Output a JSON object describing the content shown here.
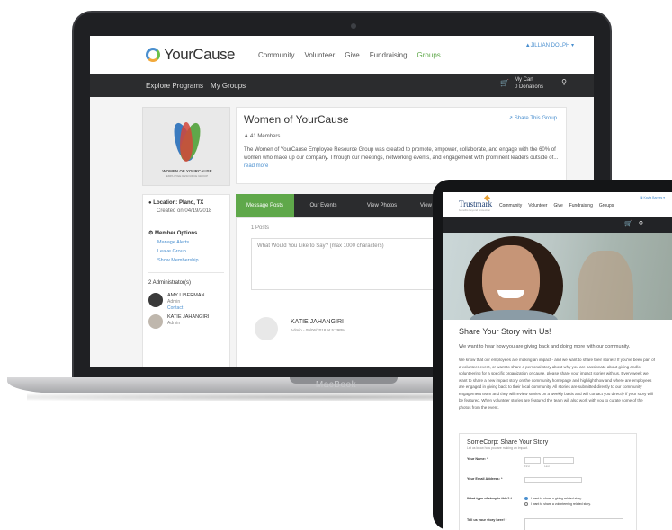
{
  "laptop": {
    "brand_label": "MacBook",
    "app": {
      "logo_text": "YourCause",
      "nav": [
        "Community",
        "Volunteer",
        "Give",
        "Fundraising",
        "Groups"
      ],
      "active_nav": "Groups",
      "user_menu": "▲JILLIAN DOLPH ▾",
      "subnav": [
        "Explore Programs",
        "My Groups"
      ],
      "cart_title": "My Cart",
      "cart_count": "0 Donations",
      "group": {
        "logo_line1": "WOMEN OF YOURCAUSE",
        "logo_line2": "EMPLOYEE RESOURCE GROUP",
        "title": "Women of YourCause",
        "share_label": "Share This Group",
        "members": "41 Members",
        "description": "The Women of YourCause Employee Resource Group was created to promote, empower, collaborate, and engage with the 60% of women who make up our company. Through our meetings, networking events, and engagement with prominent leaders outside of...",
        "read_more": "read more"
      },
      "sidebar": {
        "location": "Location:  Plano, TX",
        "created": "Created on 04/19/2018",
        "options_title": "Member Options",
        "options": [
          "Manage Alerts",
          "Leave Group",
          "Show Membership"
        ],
        "admins_title": "2 Administrator(s)",
        "admins": [
          {
            "name": "AMY LIBERMAN",
            "role": "Admin",
            "contact": "Contact"
          },
          {
            "name": "KATIE JAHANGIRI",
            "role": "Admin",
            "contact": ""
          }
        ]
      },
      "tabs": [
        "Message Posts",
        "Our Events",
        "View Photos",
        "View Documents"
      ],
      "active_tab": "Message Posts",
      "posts": {
        "count": "1 Posts",
        "placeholder": "What Would You Like to Say? (max 1000 characters)",
        "author": "KATIE JAHANGIRI",
        "meta": "Admin - 09/06/2018 at 5:29PM"
      }
    }
  },
  "tablet": {
    "logo_text": "Trustmark",
    "logo_sub": "benefits beyond protection",
    "nav": [
      "Community",
      "Volunteer",
      "Give",
      "Fundraising",
      "Groups"
    ],
    "user_menu": "▣ Kayla Barnes ▾",
    "heading": "Share Your Story with Us!",
    "intro": "We want to hear how you are giving back and doing more with our community.",
    "body": "We know that our employees are making an impact - and we want to share their stories! If you've been part of a volunteer event, or want to share a personal story about why you are passionate about giving and/or volunteering for a specific organization or cause, please share your impact stories with us. Every week we want to share a new impact story on the community homepage and highlight how and where are employees are engaged in giving back to their local community. All stories are submitted directly to our community engagement team and they will review stories on a weekly basis and will contact you directly if your story will be featured. When volunteer stories are featured the team will also work with you to curate some of the photos from the event.",
    "form": {
      "title": "SomeCorp: Share Your Story",
      "subtitle": "Let us know how you are making an impact.",
      "name_label": "Your Name: *",
      "first_caption": "First",
      "last_caption": "Last",
      "email_label": "Your Email Address: *",
      "type_label": "What type of story is this? *",
      "type_options": [
        "I want to share a giving related story.",
        "I want to share a volunteering related story."
      ],
      "story_label": "Tell us your story here! *"
    }
  },
  "colors": {
    "accent_green": "#5fa84a",
    "link_blue": "#4a8fcf",
    "dark_bar": "#2b2c2e"
  }
}
